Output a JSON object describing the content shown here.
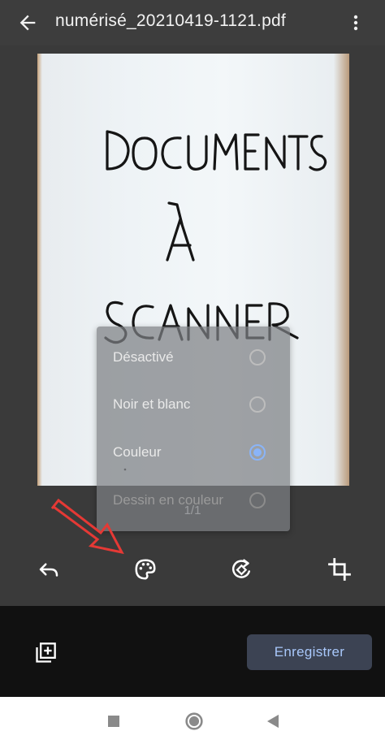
{
  "header": {
    "title": "numérisé_20210419-1121.pdf"
  },
  "document": {
    "handwritten_text": [
      "DOCUMENTS",
      "À",
      "SCANNER"
    ]
  },
  "page_counter": "1/1",
  "color_menu": {
    "items": [
      {
        "label": "Désactivé",
        "selected": false
      },
      {
        "label": "Noir et blanc",
        "selected": false
      },
      {
        "label": "Couleur",
        "selected": true
      },
      {
        "label": "Dessin en couleur",
        "selected": false
      }
    ]
  },
  "toolbar": {
    "icons": [
      "undo-icon",
      "palette-icon",
      "rotate-icon",
      "crop-icon"
    ]
  },
  "bottom": {
    "save_label": "Enregistrer",
    "add_page_icon": "add-page-icon"
  },
  "colors": {
    "accent": "#8ab4f8",
    "save_button_bg": "#3c4353",
    "save_button_text": "#a8c7fa",
    "annotation_arrow": "#e53935"
  }
}
